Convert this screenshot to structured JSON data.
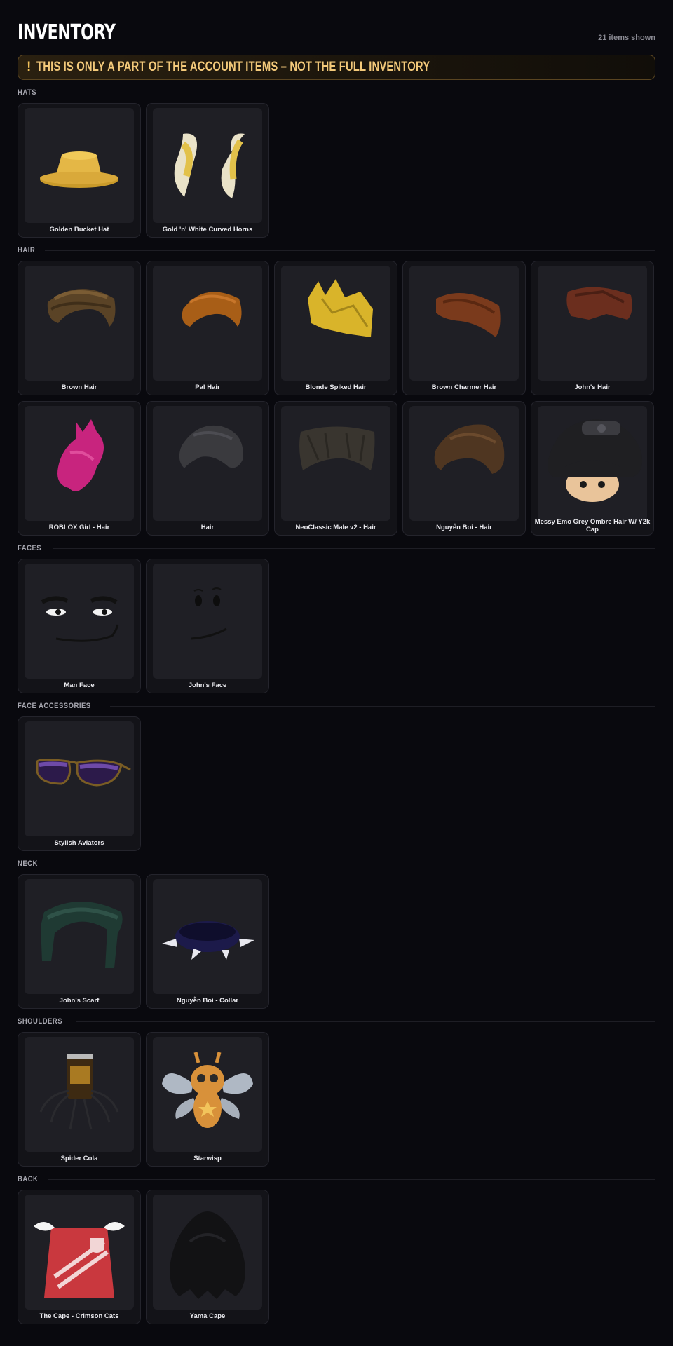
{
  "page": {
    "title": "INVENTORY",
    "item_count": "21 items shown",
    "banner_icon": "!",
    "banner": "THIS IS ONLY A PART OF THE ACCOUNT ITEMS – NOT THE FULL INVENTORY"
  },
  "colors": {
    "background": "#09090e",
    "banner_text": "#f3c97a",
    "card": "#131318",
    "thumb": "#1f1f25"
  },
  "sections": [
    {
      "label": "HATS",
      "items": [
        {
          "name": "Golden Bucket Hat",
          "icon": "hat-icon"
        },
        {
          "name": "Gold 'n' White Curved Horns",
          "icon": "horns-icon"
        }
      ]
    },
    {
      "label": "HAIR",
      "items": [
        {
          "name": "Brown Hair",
          "icon": "hair-icon"
        },
        {
          "name": "Pal Hair",
          "icon": "hair-icon"
        },
        {
          "name": "Blonde Spiked Hair",
          "icon": "spiked-hair-icon"
        },
        {
          "name": "Brown Charmer Hair",
          "icon": "hair-icon"
        },
        {
          "name": "John's Hair",
          "icon": "hair-icon"
        },
        {
          "name": "ROBLOX Girl - Hair",
          "icon": "hair-icon"
        },
        {
          "name": "Hair",
          "icon": "hair-icon"
        },
        {
          "name": "NeoClassic Male v2 - Hair",
          "icon": "hair-icon"
        },
        {
          "name": "Nguyễn Boi - Hair",
          "icon": "hair-icon"
        },
        {
          "name": "Messy Emo Grey Ombre Hair W/ Y2k Cap",
          "icon": "emo-head-icon"
        }
      ]
    },
    {
      "label": "FACES",
      "items": [
        {
          "name": "Man Face",
          "icon": "face-icon"
        },
        {
          "name": "John's Face",
          "icon": "face-icon"
        }
      ]
    },
    {
      "label": "FACE ACCESSORIES",
      "items": [
        {
          "name": "Stylish Aviators",
          "icon": "sunglasses-icon"
        }
      ]
    },
    {
      "label": "NECK",
      "items": [
        {
          "name": "John's Scarf",
          "icon": "scarf-icon"
        },
        {
          "name": "Nguyễn Boi - Collar",
          "icon": "collar-icon"
        }
      ]
    },
    {
      "label": "SHOULDERS",
      "items": [
        {
          "name": "Spider Cola",
          "icon": "spider-icon"
        },
        {
          "name": "Starwisp",
          "icon": "creature-icon"
        }
      ]
    },
    {
      "label": "BACK",
      "items": [
        {
          "name": "The Cape - Crimson Cats",
          "icon": "cape-icon"
        },
        {
          "name": "Yama Cape",
          "icon": "cape-icon"
        }
      ]
    }
  ]
}
